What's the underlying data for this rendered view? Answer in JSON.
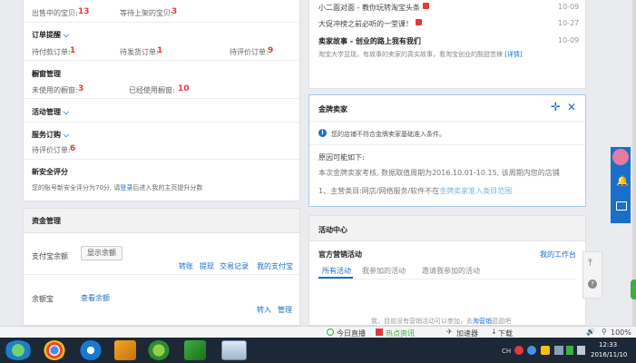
{
  "left": {
    "shop_row": {
      "label_a": "出售中的宝贝:",
      "value_a": "13",
      "label_b": "等待上架的宝贝:",
      "value_b": "3"
    },
    "orders": {
      "title": "订单提醒",
      "label_a": "待付款订单:",
      "value_a": "1",
      "label_b": "待发货订单:",
      "value_b": "1",
      "label_c": "待评价订单:",
      "value_c": "9"
    },
    "showcase": {
      "title": "橱窗管理",
      "label_a": "未使用的橱窗:",
      "value_a": "3",
      "label_b": "已经使用橱窗:",
      "value_b": "10"
    },
    "activity": {
      "title": "活动管理"
    },
    "service": {
      "title": "服务订购",
      "label_a": "待评价订单:",
      "value_a": "6"
    },
    "security": {
      "title": "新安全评分",
      "text_before": "您的账号新安全评分为70分, 请",
      "link": "登录",
      "text_after": "后进入我的主页提升分数"
    },
    "funds": {
      "title": "资金管理",
      "alipay_label": "支付宝余额",
      "show_balance": "显示余额",
      "links": [
        "转账",
        "提现",
        "交易记录",
        "我的支付宝"
      ],
      "yuebao_label": "余额宝",
      "view_balance": "查看余额",
      "transfer_in": "转入",
      "manage": "管理"
    }
  },
  "right": {
    "news": [
      {
        "title": "小二面对面 - 教你玩转淘宝头条",
        "date": "10-09"
      },
      {
        "title": "大促冲榜之前必听的一堂课！",
        "date": "10-27"
      },
      {
        "title": "卖家故事 - 创业的路上我有我们",
        "date": "10-09"
      }
    ],
    "news_desc": "淘宝大学显现，有故事的卖家的真实故事，看淘宝创业的酸甜苦辣",
    "news_desc_link": "[详情]",
    "gold": {
      "title": "金牌卖家",
      "notice": "您的店铺不符合金牌卖家基础准入条件。",
      "reason_title": "原因可能如下:",
      "reason_1": "本次金牌卖家考核, 数据取值周期为2016.10.01-10.15, 该周期内您的店铺",
      "reason_2_before": "1、主营类目:网店/网络服务/软件不在",
      "reason_2_link": "金牌卖家准入类目范围"
    },
    "activity_center": {
      "title": "活动中心",
      "subtitle": "官方营销活动",
      "workbench": "我的工作台",
      "tabs": [
        "所有活动",
        "我参加的活动",
        "邀请我参加的活动"
      ],
      "empty_before": "我，目前没有营销活动可以参加，去",
      "empty_link": "淘营销",
      "empty_after": "逛逛吧"
    }
  },
  "status": {
    "today_live": "今日直播",
    "hotspot": "热点资讯",
    "accelerator": "加速器",
    "download": "下载",
    "zoom": "100%"
  },
  "clock": {
    "time": "12:33",
    "date": "2016/11/10"
  },
  "tray": {
    "lang": "CH"
  },
  "colors": {
    "accent": "#1a6fc9",
    "highlight": "#e4393c",
    "taskbar": "#1c2836"
  }
}
